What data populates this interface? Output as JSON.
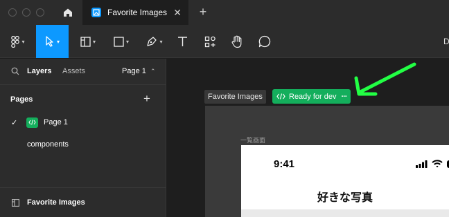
{
  "tab": {
    "title": "Favorite Images"
  },
  "toolbar": {
    "overflow_text": "D"
  },
  "left_panel": {
    "tabs": {
      "layers": "Layers",
      "assets": "Assets",
      "page_selector": "Page 1"
    },
    "pages_header": "Pages",
    "pages": [
      {
        "label": "Page 1",
        "selected": true
      },
      {
        "label": "components",
        "selected": false
      }
    ],
    "bottom_item": "Favorite Images"
  },
  "canvas": {
    "frame_label": "Favorite Images",
    "ready_badge": "Ready for dev",
    "ready_badge_more": "···",
    "screen_label": "一覧画面",
    "phone_time": "9:41",
    "phone_title": "好きな写真"
  },
  "colors": {
    "accent": "#0d99ff",
    "ready_green": "#14ae5c",
    "annotation_arrow": "#22ff44"
  }
}
